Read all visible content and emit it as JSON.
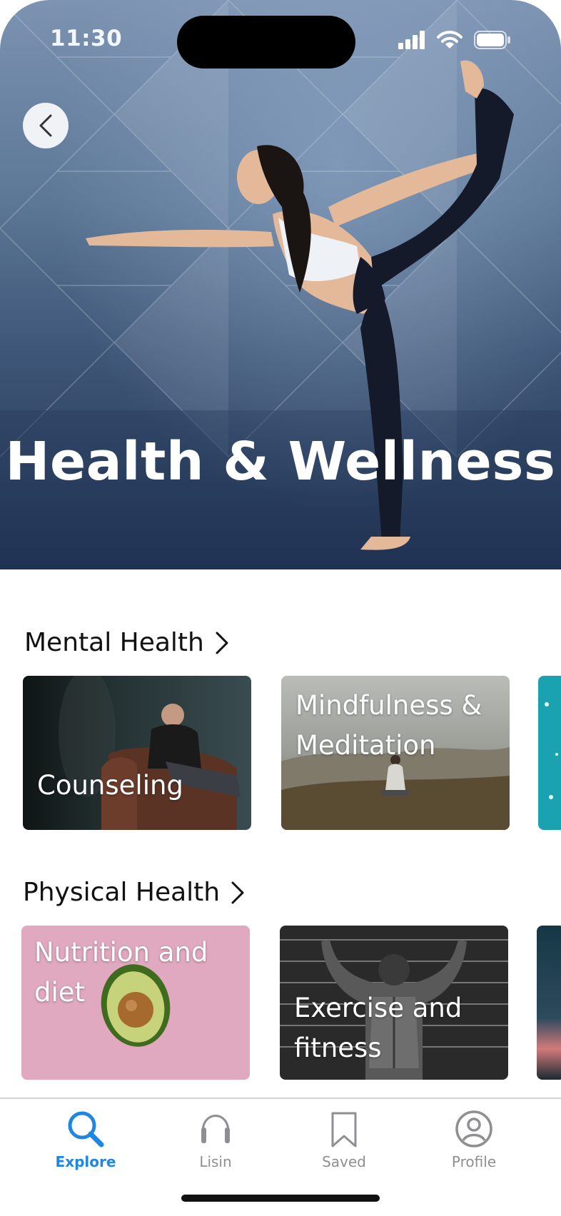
{
  "status_bar": {
    "time": "11:30"
  },
  "hero": {
    "title": "Health & Wellness"
  },
  "sections": {
    "mental": {
      "title": "Mental Health",
      "cards": [
        "Counseling",
        "Mindfulness & Meditation"
      ]
    },
    "physical": {
      "title": "Physical Health",
      "cards": [
        "Nutrition and diet",
        "Exercise and fitness"
      ]
    }
  },
  "tab_bar": {
    "tabs": [
      {
        "label": "Explore",
        "icon": "search-icon",
        "active": true
      },
      {
        "label": "Lisin",
        "icon": "headphones-icon",
        "active": false
      },
      {
        "label": "Saved",
        "icon": "bookmark-icon",
        "active": false
      },
      {
        "label": "Profile",
        "icon": "profile-icon",
        "active": false
      }
    ]
  },
  "colors": {
    "accent": "#1f86e4",
    "inactive": "#8e8e93",
    "nutrition_card": "#e0a9bf"
  }
}
